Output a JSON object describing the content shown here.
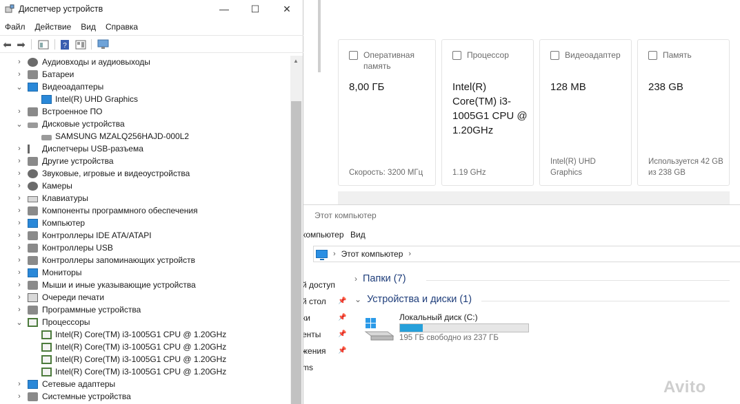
{
  "settings_cards": [
    {
      "title": "Оперативная память",
      "value": "8,00 ГБ",
      "footer": "Скорость: 3200 МГц",
      "icon": "memory-icon"
    },
    {
      "title": "Процессор",
      "value": "Intel(R) Core(TM) i3-1005G1 CPU @ 1.20GHz",
      "footer": "1.19 GHz",
      "icon": "processor-icon"
    },
    {
      "title": "Видеоадаптер",
      "value": "128 MB",
      "footer": "Intel(R) UHD Graphics",
      "icon": "video-adapter-icon"
    },
    {
      "title": "Память",
      "value": "238 GB",
      "footer": "Используется 42 GB из 238 GB",
      "icon": "storage-icon"
    }
  ],
  "explorer": {
    "title": "Этот компьютер",
    "menu": [
      "компьютер",
      "Вид"
    ],
    "breadcrumb": "Этот компьютер",
    "nav_items": [
      "й доступ",
      "й стол",
      "ки",
      "енты",
      "жения",
      "ms"
    ],
    "groups": [
      {
        "label": "Папки (7)",
        "expanded": false
      },
      {
        "label": "Устройства и диски (1)",
        "expanded": true
      }
    ],
    "drive": {
      "label": "Локальный диск (C:)",
      "free_text": "195 ГБ свободно из 237 ГБ",
      "used_fraction": 0.18
    }
  },
  "device_manager": {
    "title": "Диспетчер устройств",
    "window_controls": {
      "minimize": "—",
      "maximize": "☐",
      "close": "✕"
    },
    "menu": [
      "Файл",
      "Действие",
      "Вид",
      "Справка"
    ],
    "tree": [
      {
        "label": "Аудиовходы и аудиовыходы",
        "level": 0,
        "expander": "›",
        "icon": "speaker-icon"
      },
      {
        "label": "Батареи",
        "level": 0,
        "expander": "›",
        "icon": "battery-icon"
      },
      {
        "label": "Видеоадаптеры",
        "level": 0,
        "expander": "⌄",
        "icon": "display-adapter-icon"
      },
      {
        "label": "Intel(R) UHD Graphics",
        "level": 1,
        "expander": "",
        "icon": "display-adapter-icon"
      },
      {
        "label": "Встроенное ПО",
        "level": 0,
        "expander": "›",
        "icon": "firmware-icon"
      },
      {
        "label": "Дисковые устройства",
        "level": 0,
        "expander": "⌄",
        "icon": "disk-icon"
      },
      {
        "label": "SAMSUNG MZALQ256HAJD-000L2",
        "level": 1,
        "expander": "",
        "icon": "disk-icon"
      },
      {
        "label": "Диспетчеры USB-разъема",
        "level": 0,
        "expander": "›",
        "icon": "usb-icon"
      },
      {
        "label": "Другие устройства",
        "level": 0,
        "expander": "›",
        "icon": "unknown-device-icon"
      },
      {
        "label": "Звуковые, игровые и видеоустройства",
        "level": 0,
        "expander": "›",
        "icon": "speaker-icon"
      },
      {
        "label": "Камеры",
        "level": 0,
        "expander": "›",
        "icon": "camera-icon"
      },
      {
        "label": "Клавиатуры",
        "level": 0,
        "expander": "›",
        "icon": "keyboard-icon"
      },
      {
        "label": "Компоненты программного обеспечения",
        "level": 0,
        "expander": "›",
        "icon": "software-component-icon"
      },
      {
        "label": "Компьютер",
        "level": 0,
        "expander": "›",
        "icon": "computer-icon"
      },
      {
        "label": "Контроллеры IDE ATA/ATAPI",
        "level": 0,
        "expander": "›",
        "icon": "ide-controller-icon"
      },
      {
        "label": "Контроллеры USB",
        "level": 0,
        "expander": "›",
        "icon": "usb-controller-icon"
      },
      {
        "label": "Контроллеры запоминающих устройств",
        "level": 0,
        "expander": "›",
        "icon": "storage-controller-icon"
      },
      {
        "label": "Мониторы",
        "level": 0,
        "expander": "›",
        "icon": "monitor-icon"
      },
      {
        "label": "Мыши и иные указывающие устройства",
        "level": 0,
        "expander": "›",
        "icon": "mouse-icon"
      },
      {
        "label": "Очереди печати",
        "level": 0,
        "expander": "›",
        "icon": "printer-icon"
      },
      {
        "label": "Программные устройства",
        "level": 0,
        "expander": "›",
        "icon": "software-device-icon"
      },
      {
        "label": "Процессоры",
        "level": 0,
        "expander": "⌄",
        "icon": "cpu-icon"
      },
      {
        "label": "Intel(R) Core(TM) i3-1005G1 CPU @ 1.20GHz",
        "level": 1,
        "expander": "",
        "icon": "cpu-icon"
      },
      {
        "label": "Intel(R) Core(TM) i3-1005G1 CPU @ 1.20GHz",
        "level": 1,
        "expander": "",
        "icon": "cpu-icon"
      },
      {
        "label": "Intel(R) Core(TM) i3-1005G1 CPU @ 1.20GHz",
        "level": 1,
        "expander": "",
        "icon": "cpu-icon"
      },
      {
        "label": "Intel(R) Core(TM) i3-1005G1 CPU @ 1.20GHz",
        "level": 1,
        "expander": "",
        "icon": "cpu-icon"
      },
      {
        "label": "Сетевые адаптеры",
        "level": 0,
        "expander": "›",
        "icon": "network-adapter-icon"
      },
      {
        "label": "Системные устройства",
        "level": 0,
        "expander": "›",
        "icon": "system-device-icon"
      }
    ]
  },
  "watermark": "Avito",
  "colors": {
    "accent": "#26a0da",
    "link_blue": "#1e3d7a",
    "cpu_green": "#4b7a3b"
  }
}
